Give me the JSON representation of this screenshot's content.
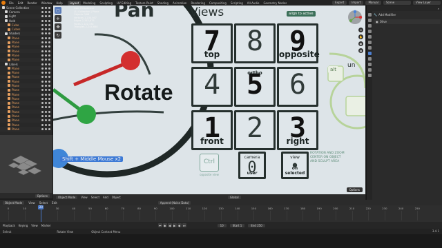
{
  "menu": [
    "File",
    "Edit",
    "Render",
    "Window",
    "Help"
  ],
  "workspace_tabs": [
    "Layout",
    "Modeling",
    "Sculpting",
    "UV Editing",
    "Texture Paint",
    "Shading",
    "Animation",
    "Rendering",
    "Compositing",
    "Scripting",
    "All-Audio",
    "Geometry Nodes"
  ],
  "workspace_active_index": 0,
  "top_right": {
    "export": "Export",
    "import": "Import",
    "manual": "Manual",
    "scene": "Scene",
    "view_layer": "View Layer"
  },
  "outliner": {
    "rows": [
      {
        "label": "Scene Collection",
        "indent": 0,
        "type": "collection"
      },
      {
        "label": "Camera",
        "indent": 1,
        "type": "collection"
      },
      {
        "label": "Light",
        "indent": 1,
        "type": "collection"
      },
      {
        "label": "Hold",
        "indent": 1,
        "type": "collection"
      },
      {
        "label": "Cube",
        "indent": 2,
        "type": "obj"
      },
      {
        "label": "Cubes",
        "indent": 2,
        "type": "obj"
      },
      {
        "label": "Shaders",
        "indent": 1,
        "type": "collection"
      },
      {
        "label": "Plane",
        "indent": 2,
        "type": "obj"
      },
      {
        "label": "Plane",
        "indent": 2,
        "type": "obj"
      },
      {
        "label": "Plane",
        "indent": 2,
        "type": "obj"
      },
      {
        "label": "Plane",
        "indent": 2,
        "type": "obj"
      },
      {
        "label": "Plane",
        "indent": 2,
        "type": "obj"
      },
      {
        "label": "Plane",
        "indent": 2,
        "type": "obj"
      },
      {
        "label": "Labels",
        "indent": 1,
        "type": "collection"
      },
      {
        "label": "Plane",
        "indent": 2,
        "type": "obj"
      },
      {
        "label": "Plane",
        "indent": 2,
        "type": "obj"
      },
      {
        "label": "Plane",
        "indent": 2,
        "type": "obj"
      },
      {
        "label": "Plane",
        "indent": 2,
        "type": "obj"
      },
      {
        "label": "Plane",
        "indent": 2,
        "type": "obj"
      },
      {
        "label": "Plane",
        "indent": 2,
        "type": "obj"
      },
      {
        "label": "Plane",
        "indent": 2,
        "type": "obj"
      },
      {
        "label": "Plane",
        "indent": 2,
        "type": "obj"
      },
      {
        "label": "Plane",
        "indent": 2,
        "type": "obj"
      },
      {
        "label": "Plane",
        "indent": 2,
        "type": "obj"
      },
      {
        "label": "Plane",
        "indent": 2,
        "type": "obj"
      },
      {
        "label": "Plane",
        "indent": 2,
        "type": "obj"
      },
      {
        "label": "Plane",
        "indent": 2,
        "type": "obj"
      },
      {
        "label": "Plane",
        "indent": 2,
        "type": "obj"
      },
      {
        "label": "Plane",
        "indent": 2,
        "type": "obj"
      }
    ]
  },
  "mini_view": {
    "options_label": "Options"
  },
  "viewport": {
    "pan_title": "Pan",
    "views_title": "Views",
    "rotate_title": "Rotate",
    "shift_hint": "Shift + Middle Mouse x2",
    "align_label": "align to active",
    "unused_label": "un",
    "note": "ROTATION AND ZOOM CENTER ON OBJECT AND SCULPT AREA",
    "ctrl_label": "Ctrl",
    "ctrl_sub": "opposite view",
    "alt_label": "alt",
    "options": "Options",
    "stats_lines": [
      "User Perspective",
      "(1) Collection | Plane",
      "Objects 0/68",
      "Vertices 1,234,567",
      "Edges 2,345,678",
      "Faces 1,122,334",
      "Triangles 2,244,668"
    ],
    "keys": [
      {
        "num": "7",
        "sub": "top",
        "dark": true
      },
      {
        "num": "8",
        "sub": "",
        "dark": false
      },
      {
        "num": "9",
        "sub": "opposite",
        "dark": true
      },
      {
        "num": "4",
        "sub": "",
        "dark": false
      },
      {
        "num": "5",
        "sub": "ortho",
        "dark": true
      },
      {
        "num": "6",
        "sub": "",
        "dark": false
      },
      {
        "num": "1",
        "sub": "front",
        "dark": true
      },
      {
        "num": "2",
        "sub": "",
        "dark": false
      },
      {
        "num": "3",
        "sub": "right",
        "dark": true
      }
    ],
    "bottom_keys": [
      {
        "num": "0",
        "top": "camera",
        "sub": "user"
      },
      {
        "num": "•",
        "top": "view",
        "sub": "on selected"
      }
    ]
  },
  "viewport_footer": {
    "mode": "Object Mode",
    "items": [
      "View",
      "Select",
      "Add",
      "Object"
    ],
    "orientation": "Global"
  },
  "left_footer": {
    "mode": "Object Mode",
    "items": [
      "View",
      "Sel",
      "Add"
    ]
  },
  "properties": {
    "add_modifier": "Add Modifier",
    "object_name": "Olive"
  },
  "timeline_head": {
    "mode": "Object Mode",
    "items": [
      "View",
      "Select",
      "Edit"
    ],
    "keying": "Append (Noise Data)"
  },
  "timeline": {
    "ticks": [
      0,
      10,
      20,
      30,
      40,
      50,
      60,
      70,
      80,
      90,
      100,
      110,
      120,
      130,
      140,
      150,
      160,
      170,
      180,
      190,
      200,
      210,
      220,
      230,
      240,
      250
    ],
    "current_frame": 20,
    "range_max": 260
  },
  "playback": {
    "items": [
      "Playback",
      "Keying",
      "View",
      "Marker"
    ],
    "current": "10",
    "start_label": "Start",
    "start": "1",
    "end_label": "End",
    "end": "250"
  },
  "status": {
    "select": "Select",
    "rotate_view": "Rotate View",
    "context_menu": "Object Context Menu",
    "version": "3.4.1"
  }
}
